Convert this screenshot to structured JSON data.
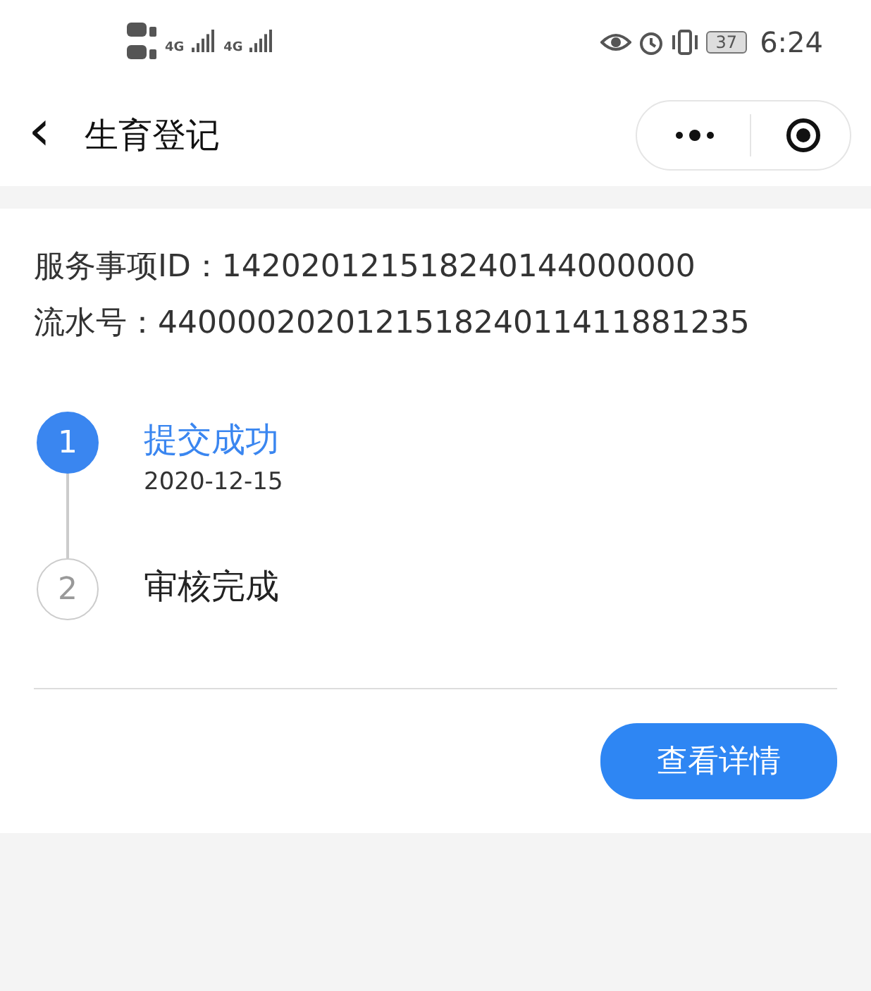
{
  "status_bar": {
    "network_labels": [
      "4G",
      "4G"
    ],
    "battery": "37",
    "time": "6:24"
  },
  "nav": {
    "title": "生育登记",
    "back": "‹"
  },
  "info": [
    {
      "label": "服务事项ID：",
      "value": "142020121518240144000000"
    },
    {
      "label": "流水号：",
      "value": "440000202012151824011411881235"
    }
  ],
  "steps": [
    {
      "number": "1",
      "title": "提交成功",
      "date": "2020-12-15",
      "selected": true
    },
    {
      "number": "2",
      "title": "审核完成",
      "selected": false
    }
  ],
  "button": "查看详情"
}
